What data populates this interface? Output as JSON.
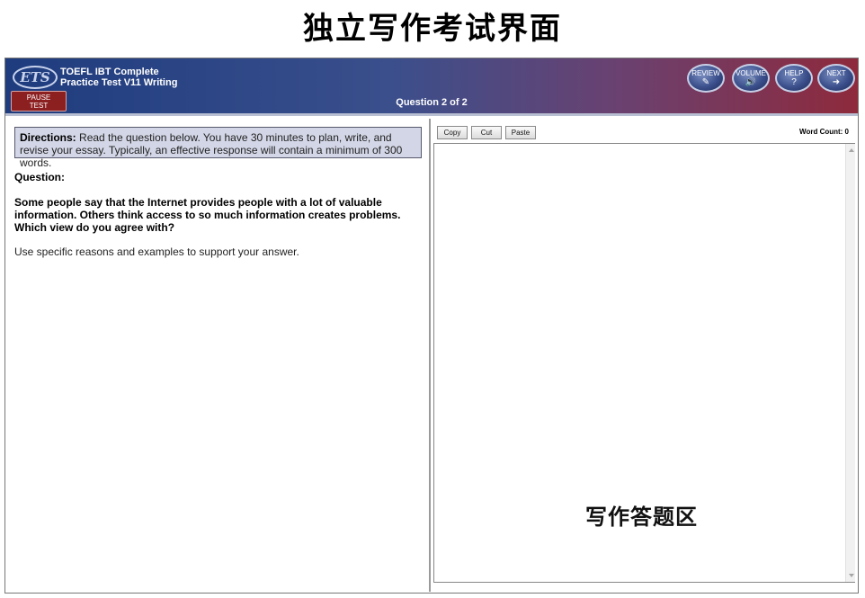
{
  "page": {
    "heading": "独立写作考试界面"
  },
  "header": {
    "logo_text": "ETS",
    "title_line1": "TOEFL IBT Complete",
    "title_line2": "Practice Test V11 Writing",
    "pause_line1": "PAUSE",
    "pause_line2": "TEST",
    "question_counter": "Question 2 of 2",
    "nav": [
      {
        "label": "REVIEW",
        "icon": "review-icon",
        "glyph": "✎"
      },
      {
        "label": "VOLUME",
        "icon": "volume-icon",
        "glyph": "🔊"
      },
      {
        "label": "HELP",
        "icon": "help-icon",
        "glyph": "?"
      },
      {
        "label": "NEXT",
        "icon": "next-arrow-icon",
        "glyph": "➜"
      }
    ]
  },
  "left": {
    "directions_label": "Directions:",
    "directions_text": " Read the question below. You have 30 minutes to plan, write, and revise your essay. Typically, an effective response will contain a minimum of 300 words.",
    "question_label": "Question:",
    "question_text": "Some people say that the Internet provides people with a lot of valuable information. Others think access to so much information creates problems. Which view do you agree with?",
    "instruction": "Use specific reasons and examples to support your answer."
  },
  "right": {
    "toolbar": {
      "copy": "Copy",
      "cut": "Cut",
      "paste": "Paste"
    },
    "word_count": "Word Count: 0",
    "essay_value": "",
    "answer_area_label": "写作答题区"
  },
  "colors": {
    "header_start": "#1e3c7e",
    "header_end": "#8e2a3c",
    "pause_button": "#8c1f1f",
    "directions_bg": "#d3d6e6"
  }
}
